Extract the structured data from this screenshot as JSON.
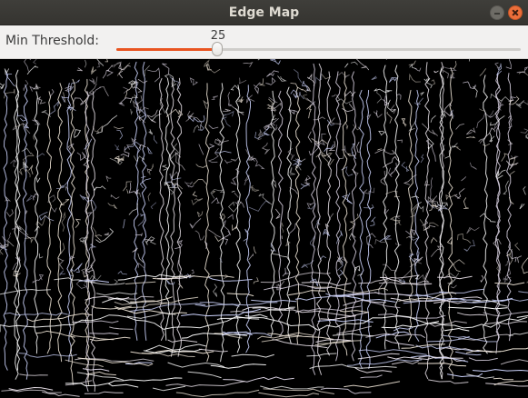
{
  "window": {
    "title": "Edge Map"
  },
  "trackbar": {
    "label": "Min Threshold:",
    "value": 25,
    "value_text": "25",
    "min": 0,
    "max": 100,
    "fill_color": "#e95420"
  },
  "image": {
    "description_icon": "edge-map-image",
    "edge_color": "#ffffff",
    "background_color": "#000000"
  },
  "icons": {
    "minimize": "minimize-icon",
    "close": "close-icon"
  }
}
